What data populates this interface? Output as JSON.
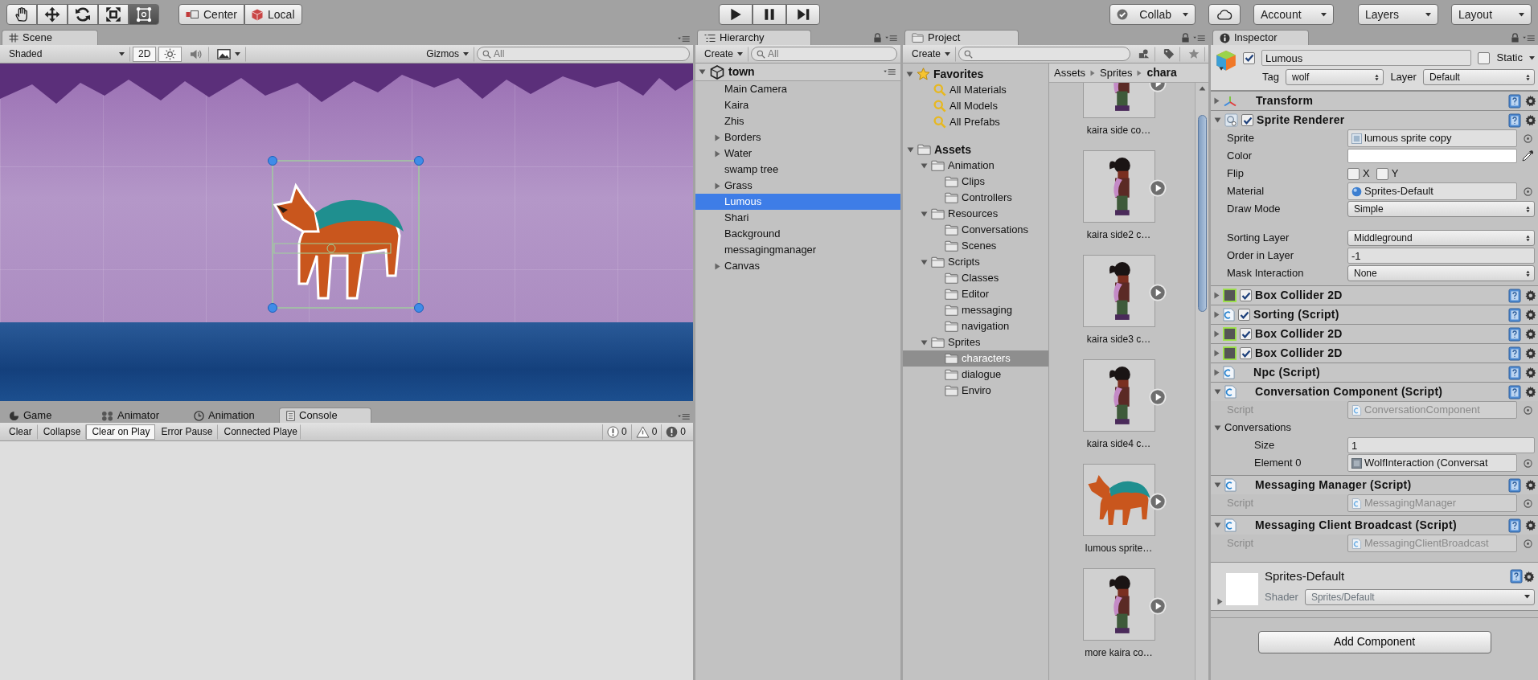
{
  "toolbar": {
    "tools": [
      {
        "kind": "hand",
        "selected": false
      },
      {
        "kind": "move",
        "selected": false
      },
      {
        "kind": "rotate",
        "selected": false
      },
      {
        "kind": "scale",
        "selected": false
      },
      {
        "kind": "rect",
        "selected": true
      }
    ],
    "pivot": [
      {
        "kind": "center",
        "label": "Center"
      },
      {
        "kind": "local",
        "label": "Local"
      }
    ],
    "playback": [
      {
        "kind": "play"
      },
      {
        "kind": "pause"
      },
      {
        "kind": "step"
      }
    ],
    "services": [
      {
        "kind": "collab",
        "label": "Collab"
      },
      {
        "kind": "cloud"
      },
      {
        "kind": "plain",
        "label": "Account"
      },
      {
        "kind": "plain",
        "label": "Layers"
      },
      {
        "kind": "plain",
        "label": "Layout"
      }
    ]
  },
  "scene": {
    "tab": "Scene",
    "shading": "Shaded",
    "mode_2d": {
      "label": "2D",
      "selected": true
    },
    "toggles": [
      {
        "kind": "lighting",
        "selected": true
      },
      {
        "kind": "audio",
        "selected": false
      },
      {
        "kind": "effects",
        "selected": false
      }
    ],
    "gizmos": "Gizmos",
    "search_placeholder": "All"
  },
  "bottom_panel": {
    "tabs": [
      {
        "kind": "game",
        "label": "Game",
        "selected": false
      },
      {
        "kind": "animator",
        "label": "Animator",
        "selected": false
      },
      {
        "kind": "animation",
        "label": "Animation",
        "selected": false
      },
      {
        "kind": "console",
        "label": "Console",
        "selected": true
      }
    ],
    "console_buttons": [
      {
        "kind": "toggle",
        "label": "Clear",
        "selected": false
      },
      {
        "kind": "toggle",
        "label": "Collapse",
        "selected": false
      },
      {
        "kind": "toggle",
        "label": "Clear on Play",
        "selected": true
      },
      {
        "kind": "toggle",
        "label": "Error Pause",
        "selected": false
      },
      {
        "kind": "dropdown",
        "label": "Connected Playe",
        "selected": false
      }
    ],
    "counters": [
      {
        "kind": "info",
        "count": "0"
      },
      {
        "kind": "warning",
        "count": "0"
      },
      {
        "kind": "error",
        "count": "0"
      }
    ]
  },
  "hierarchy": {
    "tab": "Hierarchy",
    "create": "Create",
    "search_placeholder": "All",
    "scene": "town",
    "items": [
      {
        "label": "Main Camera",
        "collapsed": false,
        "selected": false
      },
      {
        "label": "Kaira",
        "collapsed": false,
        "selected": false
      },
      {
        "label": "Zhis",
        "collapsed": false,
        "selected": false
      },
      {
        "label": "Borders",
        "collapsed": true,
        "selected": false
      },
      {
        "label": "Water",
        "collapsed": true,
        "selected": false
      },
      {
        "label": "swamp tree",
        "collapsed": false,
        "selected": false
      },
      {
        "label": "Grass",
        "collapsed": true,
        "selected": false
      },
      {
        "label": "Lumous",
        "collapsed": false,
        "selected": true
      },
      {
        "label": "Shari",
        "collapsed": false,
        "selected": false
      },
      {
        "label": "Background",
        "collapsed": false,
        "selected": false
      },
      {
        "label": "messagingmanager",
        "collapsed": false,
        "selected": false
      },
      {
        "label": "Canvas",
        "collapsed": true,
        "selected": false
      }
    ]
  },
  "project": {
    "tab": "Project",
    "create": "Create",
    "favorites": {
      "label": "Favorites",
      "items": [
        {
          "label": "All Materials",
          "selected": false
        },
        {
          "label": "All Models",
          "selected": false
        },
        {
          "label": "All Prefabs",
          "selected": false
        }
      ]
    },
    "assets": {
      "label": "Assets",
      "selected": false,
      "children": [
        {
          "label": "Animation",
          "selected": false,
          "children": [
            {
              "label": "Clips",
              "selected": false
            },
            {
              "label": "Controllers",
              "selected": false
            }
          ]
        },
        {
          "label": "Resources",
          "selected": false,
          "children": [
            {
              "label": "Conversations",
              "selected": false
            },
            {
              "label": "Scenes",
              "selected": false
            }
          ]
        },
        {
          "label": "Scripts",
          "selected": false,
          "children": [
            {
              "label": "Classes",
              "selected": false
            },
            {
              "label": "Editor",
              "selected": false
            },
            {
              "label": "messaging",
              "selected": false
            },
            {
              "label": "navigation",
              "selected": false
            }
          ]
        },
        {
          "label": "Sprites",
          "selected": false,
          "children": [
            {
              "label": "characters",
              "selected": true
            },
            {
              "label": "dialogue",
              "selected": false
            },
            {
              "label": "Enviro",
              "selected": false
            }
          ]
        }
      ]
    },
    "breadcrumb": [
      "Assets",
      "Sprites",
      "chara"
    ],
    "grid": [
      {
        "kind": "character",
        "label": "kaira side co…"
      },
      {
        "kind": "character",
        "label": "kaira side2 c…"
      },
      {
        "kind": "character",
        "label": "kaira side3 c…"
      },
      {
        "kind": "character",
        "label": "kaira side4 c…"
      },
      {
        "kind": "wolf",
        "label": "lumous sprite…"
      },
      {
        "kind": "character",
        "label": "more kaira co…"
      }
    ]
  },
  "inspector": {
    "tab": "Inspector",
    "object": {
      "active": true,
      "name": "Lumous",
      "static": false,
      "static_label": "Static",
      "tag_label": "Tag",
      "tag": "wolf",
      "layer_label": "Layer",
      "layer": "Default"
    },
    "components": [
      {
        "kind": "transform",
        "name": "Transform",
        "expanded": false
      },
      {
        "kind": "sprite",
        "name": "Sprite Renderer",
        "enabled": true,
        "expanded": true,
        "fields": [
          {
            "kind": "sprite_ref",
            "label": "Sprite",
            "value": "lumous sprite copy"
          },
          {
            "kind": "color",
            "label": "Color",
            "color": "#ffffff"
          },
          {
            "kind": "flip",
            "label": "Flip",
            "options": [
              {
                "label": "X",
                "checked": false
              },
              {
                "label": "Y",
                "checked": false
              }
            ]
          },
          {
            "kind": "material_ref",
            "label": "Material",
            "value": "Sprites-Default"
          },
          {
            "kind": "dropdown",
            "label": "Draw Mode",
            "value": "Simple"
          },
          {
            "kind": "dropdown",
            "label": "Sorting Layer",
            "value": "Middleground",
            "spaced": true
          },
          {
            "kind": "text",
            "label": "Order in Layer",
            "value": "-1"
          },
          {
            "kind": "dropdown",
            "label": "Mask Interaction",
            "value": "None"
          }
        ]
      },
      {
        "kind": "collider",
        "name": "Box Collider 2D",
        "enabled": true,
        "expanded": false
      },
      {
        "kind": "script",
        "name": "Sorting (Script)",
        "enabled": true,
        "expanded": false
      },
      {
        "kind": "collider",
        "name": "Box Collider 2D",
        "enabled": true,
        "expanded": false
      },
      {
        "kind": "collider",
        "name": "Box Collider 2D",
        "enabled": true,
        "expanded": false
      },
      {
        "kind": "script",
        "name": "Npc (Script)",
        "expanded": false
      },
      {
        "kind": "script",
        "name": "Conversation Component (Script)",
        "expanded": true,
        "fields": [
          {
            "kind": "script_ref",
            "label": "Script",
            "value": "ConversationComponent",
            "disabled": true
          },
          {
            "kind": "foldout",
            "label": "Conversations",
            "expanded": true,
            "children": [
              {
                "kind": "text",
                "label": "Size",
                "value": "1"
              },
              {
                "kind": "asset_ref",
                "label": "Element 0",
                "value": "WolfInteraction (Conversat"
              }
            ]
          }
        ]
      },
      {
        "kind": "script",
        "name": "Messaging Manager (Script)",
        "expanded": true,
        "fields": [
          {
            "kind": "script_ref",
            "label": "Script",
            "value": "MessagingManager",
            "disabled": true
          }
        ]
      },
      {
        "kind": "script",
        "name": "Messaging Client Broadcast (Script)",
        "expanded": true,
        "fields": [
          {
            "kind": "script_ref",
            "label": "Script",
            "value": "MessagingClientBroadcast",
            "disabled": true
          }
        ]
      }
    ],
    "material": {
      "name": "Sprites-Default",
      "expanded": false,
      "shader_label": "Shader",
      "shader": "Sprites/Default"
    },
    "add_component": "Add Component"
  }
}
